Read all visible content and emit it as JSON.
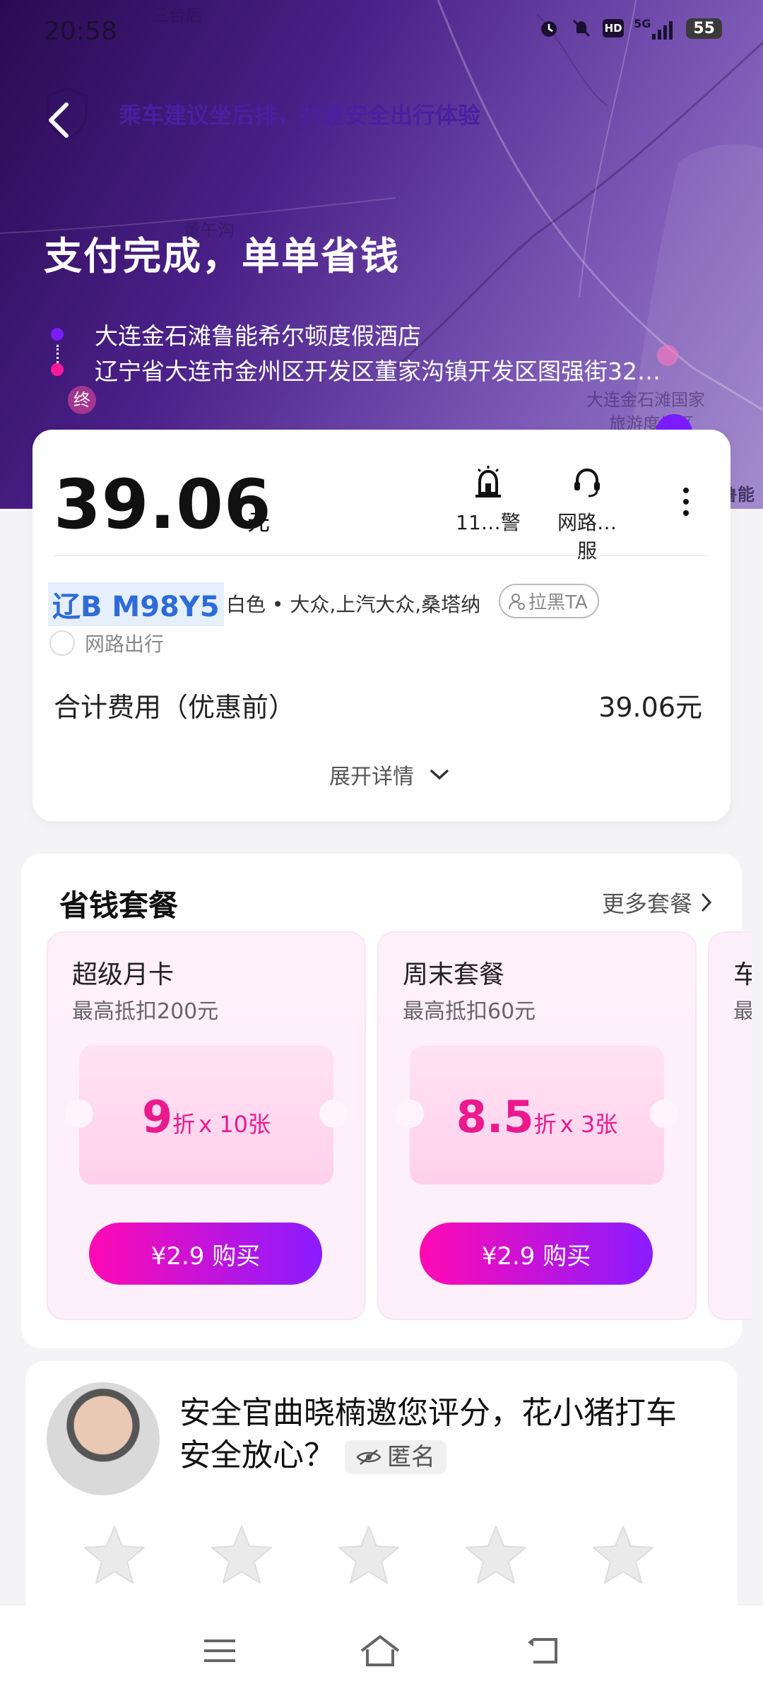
{
  "status_bar": {
    "time": "20:58",
    "network": "5G",
    "hd_label": "HD",
    "battery": "55"
  },
  "map_labels": [
    "三台后",
    "董午沟",
    "大连金石滩国家",
    "旅游度假区",
    "鲁能",
    "终"
  ],
  "safety_banner": "乘车建议坐后排，共建安全出行体验",
  "page_title": "支付完成，单单省钱",
  "route": {
    "start": "大连金石滩鲁能希尔顿度假酒店",
    "end": "辽宁省大连市金州区开发区董家沟镇开发区图强街32…",
    "start_color": "#7a1cff",
    "end_color": "#ff1a9c"
  },
  "payment": {
    "amount": "39.06",
    "unit": "元",
    "actions": [
      {
        "label": "11…警",
        "icon": "alarm-icon"
      },
      {
        "label": "网路…服",
        "icon": "headset-icon"
      }
    ],
    "plate": "辽B M98Y5",
    "car_info": "白色 • 大众,上汽大众,桑塔纳",
    "block_label": "拉黑TA",
    "company": "网路出行",
    "total_label": "合计费用（优惠前）",
    "total_value": "39.06元",
    "expand_label": "展开详情"
  },
  "packages": {
    "title": "省钱套餐",
    "more_label": "更多套餐",
    "items": [
      {
        "name": "超级月卡",
        "subtitle": "最高抵扣200元",
        "discount": "9",
        "discount_unit": "折",
        "count": "x 10张",
        "buy_label": "¥2.9 购买"
      },
      {
        "name": "周末套餐",
        "subtitle": "最高抵扣60元",
        "discount": "8.5",
        "discount_unit": "折",
        "count": "x 3张",
        "buy_label": "¥2.9 购买"
      }
    ],
    "partial_name": "车",
    "partial_sub": "最"
  },
  "rating": {
    "invite_text": "安全官曲晓楠邀您评分，花小猪打车安全放心？",
    "anonymous_label": "匿名",
    "stars_filled": 0,
    "stars_total": 5
  },
  "colors": {
    "accent": "#ea1a8e",
    "hero_start": "#2a0b52",
    "hero_end": "#9b82c8"
  }
}
